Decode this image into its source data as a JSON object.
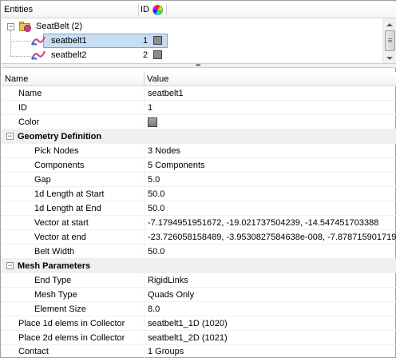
{
  "tree": {
    "header_entities": "Entities",
    "header_id": "ID",
    "collector": {
      "label": "SeatBelt (2)",
      "expander": "−"
    },
    "items": [
      {
        "label": "seatbelt1",
        "id": "1",
        "color": "#8c8c8c",
        "selected": true
      },
      {
        "label": "seatbelt2",
        "id": "2",
        "color": "#8c8c8c",
        "selected": false
      }
    ],
    "splitter_grip": "•••"
  },
  "grid": {
    "header_name": "Name",
    "header_value": "Value",
    "rows": [
      {
        "name": "Name",
        "value": "seatbelt1"
      },
      {
        "name": "ID",
        "value": "1"
      },
      {
        "name": "Color",
        "value": ""
      }
    ],
    "groups": [
      {
        "title": "Geometry Definition",
        "expander": "−",
        "rows": [
          {
            "name": "Pick Nodes",
            "value": "3 Nodes"
          },
          {
            "name": "Components",
            "value": "5 Components"
          },
          {
            "name": "Gap",
            "value": "5.0"
          },
          {
            "name": "1d Length at Start",
            "value": "50.0"
          },
          {
            "name": "1d Length at End",
            "value": "50.0"
          },
          {
            "name": "Vector at start",
            "value": "-7.1794951951672, -19.021737504239, -14.547451703388"
          },
          {
            "name": "Vector at end",
            "value": "-23.726058158489, -3.9530827584638e-008, -7.8787159017199"
          },
          {
            "name": "Belt Width",
            "value": "50.0"
          }
        ]
      },
      {
        "title": "Mesh Parameters",
        "expander": "−",
        "rows": [
          {
            "name": "End Type",
            "value": "RigidLinks"
          },
          {
            "name": "Mesh Type",
            "value": "Quads Only"
          },
          {
            "name": "Element Size",
            "value": "8.0"
          }
        ]
      }
    ],
    "tail_rows": [
      {
        "name": "Place 1d elems in Collector",
        "value": "seatbelt1_1D (1020)"
      },
      {
        "name": "Place 2d elems in Collector",
        "value": "seatbelt1_2D (1021)"
      },
      {
        "name": "Contact",
        "value": "1 Groups"
      }
    ]
  }
}
